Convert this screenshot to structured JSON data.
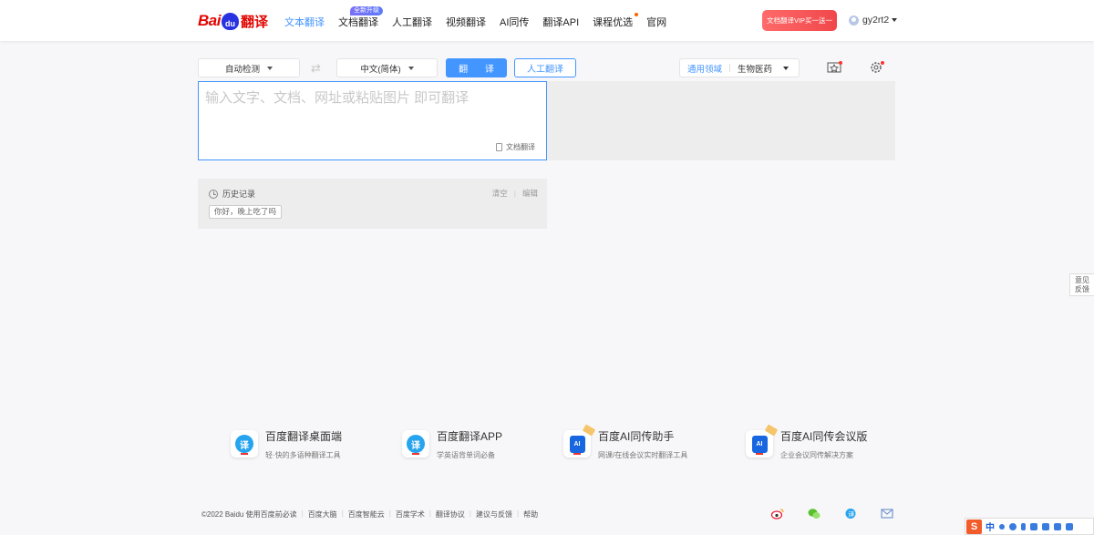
{
  "header": {
    "logo": {
      "bai": "Bai",
      "paw": "du",
      "fy": "翻译"
    },
    "nav": [
      {
        "label": "文本翻译",
        "active": true
      },
      {
        "label": "文档翻译",
        "badge": "全新升级"
      },
      {
        "label": "人工翻译"
      },
      {
        "label": "视频翻译"
      },
      {
        "label": "AI同传"
      },
      {
        "label": "翻译API"
      },
      {
        "label": "课程优选",
        "dot": true
      },
      {
        "label": "官网"
      }
    ],
    "vip_button": "文档翻译VIP买一送一",
    "username": "gy2rt2"
  },
  "toolbar": {
    "source_lang": "自动检测",
    "target_lang": "中文(简体)",
    "translate_button": "翻 译",
    "human_button": "人工翻译",
    "domain_label": "通用领域",
    "domain_value": "生物医药"
  },
  "input": {
    "placeholder": "输入文字、文档、网址或粘贴图片 即可翻译",
    "doc_link": "文档翻译"
  },
  "history": {
    "title": "历史记录",
    "clear": "清空",
    "edit": "编辑",
    "items": [
      "你好，晚上吃了吗"
    ]
  },
  "feedback": {
    "line1": "意见",
    "line2": "反馈"
  },
  "products": [
    {
      "title": "百度翻译桌面端",
      "subtitle": "轻·快的多语种翻译工具",
      "icon": "translate-app-icon"
    },
    {
      "title": "百度翻译APP",
      "subtitle": "学英语背单词必备",
      "icon": "translate-app-icon"
    },
    {
      "title": "百度AI同传助手",
      "subtitle": "网课/在线会议实时翻译工具",
      "icon": "ai-interpreter-icon"
    },
    {
      "title": "百度AI同传会议版",
      "subtitle": "企业会议同传解决方案",
      "icon": "ai-interpreter-icon"
    }
  ],
  "footer": {
    "links": [
      "©2022 Baidu  使用百度前必读",
      "百度大脑",
      "百度智能云",
      "百度学术",
      "翻译协议",
      "建议与反馈",
      "帮助"
    ]
  },
  "ime": {
    "logo": "S",
    "mode": "中"
  },
  "colors": {
    "accent": "#4395ff",
    "brand_red": "#e10602",
    "vip": "#f0474a"
  }
}
